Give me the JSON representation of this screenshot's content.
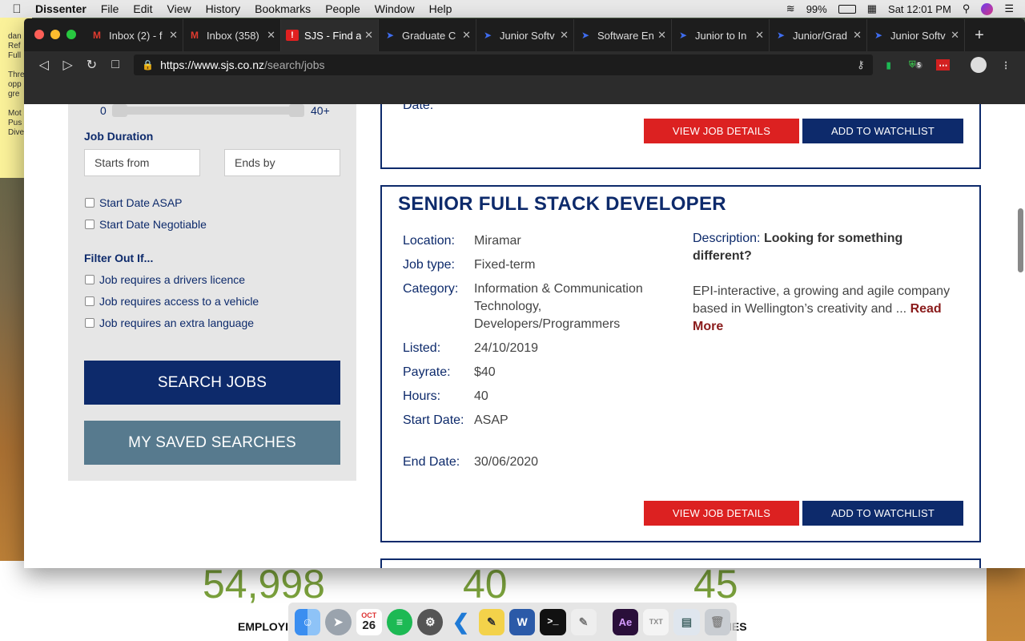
{
  "menubar": {
    "app": "Dissenter",
    "items": [
      "File",
      "Edit",
      "View",
      "History",
      "Bookmarks",
      "People",
      "Window",
      "Help"
    ],
    "battery": "99%",
    "clock": "Sat 12:01 PM"
  },
  "sticky": {
    "lines": [
      "dan",
      "Ref",
      "Full",
      "",
      "Thre",
      "opp",
      "gre",
      "",
      "Mot",
      "Pus",
      "Dive"
    ]
  },
  "tabs": [
    {
      "title": "Inbox (2) - f",
      "icon": "gmail-icon"
    },
    {
      "title": "Inbox (358)",
      "icon": "gmail-icon"
    },
    {
      "title": "SJS - Find a",
      "icon": "sjs-icon"
    },
    {
      "title": "Graduate C",
      "icon": "arrow-icon"
    },
    {
      "title": "Junior Softv",
      "icon": "arrow-icon"
    },
    {
      "title": "Software En",
      "icon": "arrow-icon"
    },
    {
      "title": "Junior to In",
      "icon": "arrow-icon"
    },
    {
      "title": "Junior/Grad",
      "icon": "arrow-icon"
    },
    {
      "title": "Junior Softv",
      "icon": "arrow-icon"
    }
  ],
  "url": {
    "host": "https://www.sjs.co.nz",
    "path": "/search/jobs"
  },
  "extensions": {
    "badge": "5"
  },
  "sidebar": {
    "slider_min": "0",
    "slider_max": "40+",
    "duration_heading": "Job Duration",
    "starts_placeholder": "Starts from",
    "ends_placeholder": "Ends by",
    "start_asap": "Start Date ASAP",
    "start_negotiable": "Start Date Negotiable",
    "filter_heading": "Filter Out If...",
    "filter_licence": "Job requires a drivers licence",
    "filter_vehicle": "Job requires access to a vehicle",
    "filter_language": "Job requires an extra language",
    "search_button": "SEARCH JOBS",
    "saved_button": "MY SAVED SEARCHES"
  },
  "prev_card": {
    "partial_label": "Date:",
    "view_label": "VIEW JOB DETAILS",
    "watch_label": "ADD TO WATCHLIST"
  },
  "job": {
    "title": "SENIOR FULL STACK DEVELOPER",
    "location_label": "Location:",
    "location": "Miramar",
    "type_label": "Job type:",
    "type": "Fixed-term",
    "category_label": "Category:",
    "category": "Information & Communication Technology, Developers/Programmers",
    "listed_label": "Listed:",
    "listed": "24/10/2019",
    "payrate_label": "Payrate:",
    "payrate": "$40",
    "hours_label": "Hours:",
    "hours": "40",
    "start_label": "Start Date:",
    "start": "ASAP",
    "end_label": "End Date:",
    "end": "30/06/2020",
    "description_label": "Description:",
    "description_lead": "Looking for something different?",
    "description_body": "EPI-interactive, a growing and agile company based in Wellington’s creativity and ...",
    "read_more": "Read More",
    "view_label": "VIEW JOB DETAILS",
    "watch_label": "ADD TO WATCHLIST"
  },
  "stats": [
    {
      "value": "54,998",
      "label": "EMPLOYI"
    },
    {
      "value": "40",
      "label": ""
    },
    {
      "value": "45",
      "label": "IES"
    }
  ],
  "dock": {
    "calendar_month": "OCT",
    "calendar_day": "26"
  }
}
